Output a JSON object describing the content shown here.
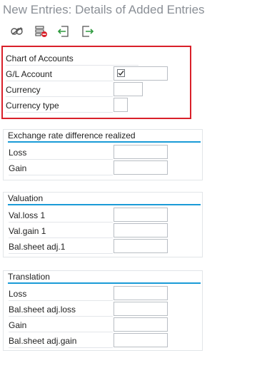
{
  "title": "New Entries: Details of Added Entries",
  "toolbar": {
    "icons": [
      "display-change-icon",
      "delete-icon",
      "previous-entry-icon",
      "next-entry-icon"
    ]
  },
  "header_fields": {
    "chart_of_accounts": {
      "label": "Chart of Accounts",
      "value": ""
    },
    "gl_account": {
      "label": "G/L Account",
      "checked": true
    },
    "currency": {
      "label": "Currency",
      "value": ""
    },
    "currency_type": {
      "label": "Currency type",
      "value": ""
    }
  },
  "groups": {
    "realized": {
      "title": "Exchange rate difference realized",
      "fields": [
        {
          "label": "Loss",
          "value": ""
        },
        {
          "label": "Gain",
          "value": ""
        }
      ]
    },
    "valuation": {
      "title": "Valuation",
      "fields": [
        {
          "label": "Val.loss 1",
          "value": ""
        },
        {
          "label": "Val.gain 1",
          "value": ""
        },
        {
          "label": "Bal.sheet adj.1",
          "value": ""
        }
      ]
    },
    "translation": {
      "title": "Translation",
      "fields": [
        {
          "label": "Loss",
          "value": ""
        },
        {
          "label": "Bal.sheet adj.loss",
          "value": ""
        },
        {
          "label": "Gain",
          "value": ""
        },
        {
          "label": "Bal.sheet adj.gain",
          "value": ""
        }
      ]
    }
  },
  "colors": {
    "highlight_border": "#d9202a",
    "group_accent": "#1a9bd7",
    "title_text": "#8a8f96"
  }
}
